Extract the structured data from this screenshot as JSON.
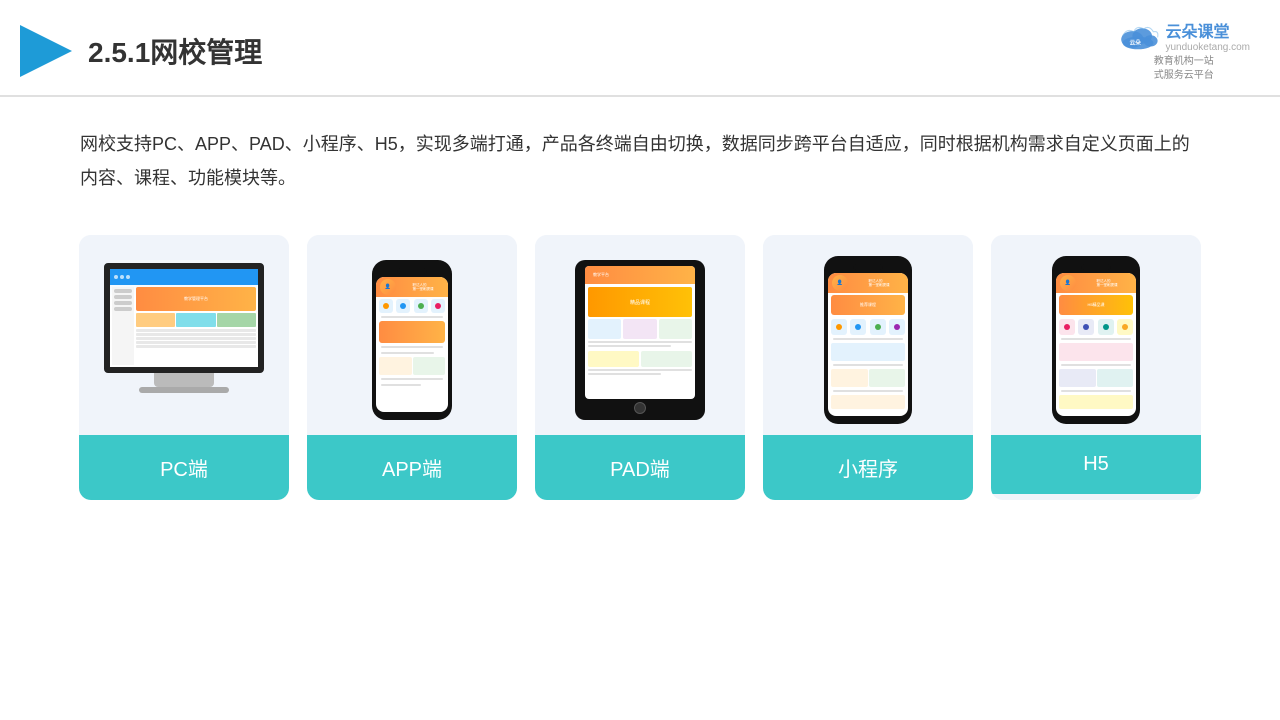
{
  "header": {
    "title": "2.5.1网校管理",
    "logo_name": "云朵课堂",
    "logo_domain": "yunduoketang.com",
    "logo_subtitle": "教育机构一站\n式服务云平台"
  },
  "description": {
    "text": "网校支持PC、APP、PAD、小程序、H5，实现多端打通，产品各终端自由切换，数据同步跨平台自适应，同时根据机构需求自定义页面上的内容、课程、功能模块等。"
  },
  "cards": [
    {
      "id": "pc",
      "label": "PC端"
    },
    {
      "id": "app",
      "label": "APP端"
    },
    {
      "id": "pad",
      "label": "PAD端"
    },
    {
      "id": "miniprogram",
      "label": "小程序"
    },
    {
      "id": "h5",
      "label": "H5"
    }
  ]
}
